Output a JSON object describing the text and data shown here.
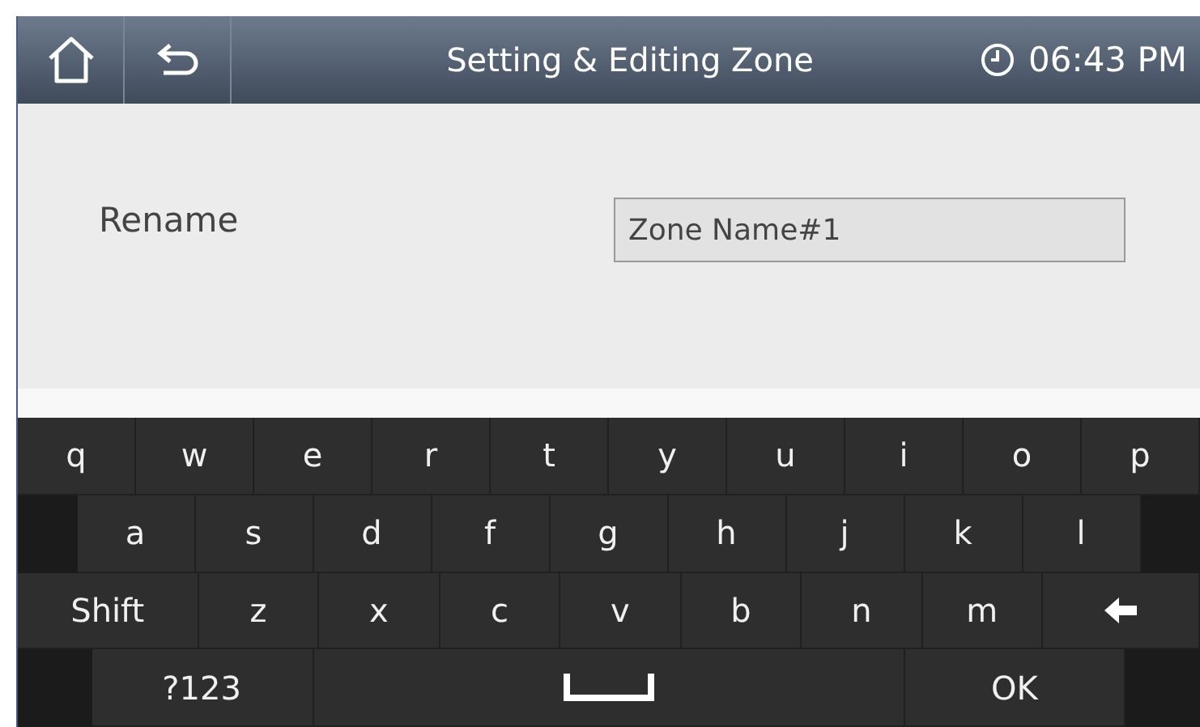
{
  "header": {
    "title": "Setting & Editing Zone",
    "time": "06:43 PM"
  },
  "form": {
    "label": "Rename",
    "value": "Zone Name#1"
  },
  "keyboard": {
    "rows": [
      {
        "keys": [
          {
            "kind": "char",
            "label": "q"
          },
          {
            "kind": "char",
            "label": "w"
          },
          {
            "kind": "char",
            "label": "e"
          },
          {
            "kind": "char",
            "label": "r"
          },
          {
            "kind": "char",
            "label": "t"
          },
          {
            "kind": "char",
            "label": "y"
          },
          {
            "kind": "char",
            "label": "u"
          },
          {
            "kind": "char",
            "label": "i"
          },
          {
            "kind": "char",
            "label": "o"
          },
          {
            "kind": "char",
            "label": "p"
          }
        ]
      },
      {
        "keys": [
          {
            "kind": "spacer"
          },
          {
            "kind": "char",
            "label": "a"
          },
          {
            "kind": "char",
            "label": "s"
          },
          {
            "kind": "char",
            "label": "d"
          },
          {
            "kind": "char",
            "label": "f"
          },
          {
            "kind": "char",
            "label": "g"
          },
          {
            "kind": "char",
            "label": "h"
          },
          {
            "kind": "char",
            "label": "j"
          },
          {
            "kind": "char",
            "label": "k"
          },
          {
            "kind": "char",
            "label": "l"
          },
          {
            "kind": "spacer"
          }
        ]
      },
      {
        "keys": [
          {
            "kind": "wide",
            "label": "Shift"
          },
          {
            "kind": "char",
            "label": "z"
          },
          {
            "kind": "char",
            "label": "x"
          },
          {
            "kind": "char",
            "label": "c"
          },
          {
            "kind": "char",
            "label": "v"
          },
          {
            "kind": "char",
            "label": "b"
          },
          {
            "kind": "char",
            "label": "n"
          },
          {
            "kind": "char",
            "label": "m"
          },
          {
            "kind": "backspace"
          }
        ]
      },
      {
        "keys": [
          {
            "kind": "spacer"
          },
          {
            "kind": "wide",
            "label": "?123"
          },
          {
            "kind": "space"
          },
          {
            "kind": "wide",
            "label": "OK"
          },
          {
            "kind": "spacer"
          }
        ]
      }
    ]
  }
}
